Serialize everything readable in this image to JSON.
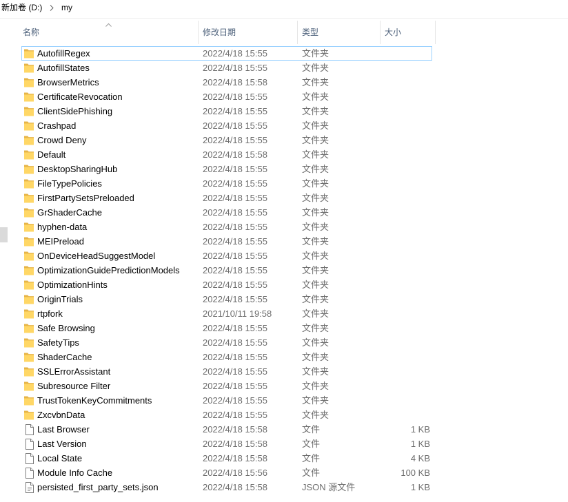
{
  "breadcrumb": {
    "items": [
      "新加卷 (D:)",
      "my"
    ],
    "separator_icon": "chevron-right-icon"
  },
  "header": {
    "name": "名称",
    "modified": "修改日期",
    "type": "类型",
    "size": "大小",
    "sort_icon": "sort-ascending-icon"
  },
  "files": [
    {
      "name": "AutofillRegex",
      "modified": "2022/4/18 15:55",
      "type": "文件夹",
      "icon": "folder-icon",
      "focused": true
    },
    {
      "name": "AutofillStates",
      "modified": "2022/4/18 15:55",
      "type": "文件夹",
      "icon": "folder-icon"
    },
    {
      "name": "BrowserMetrics",
      "modified": "2022/4/18 15:58",
      "type": "文件夹",
      "icon": "folder-icon"
    },
    {
      "name": "CertificateRevocation",
      "modified": "2022/4/18 15:55",
      "type": "文件夹",
      "icon": "folder-icon"
    },
    {
      "name": "ClientSidePhishing",
      "modified": "2022/4/18 15:55",
      "type": "文件夹",
      "icon": "folder-icon"
    },
    {
      "name": "Crashpad",
      "modified": "2022/4/18 15:55",
      "type": "文件夹",
      "icon": "folder-icon"
    },
    {
      "name": "Crowd Deny",
      "modified": "2022/4/18 15:55",
      "type": "文件夹",
      "icon": "folder-icon"
    },
    {
      "name": "Default",
      "modified": "2022/4/18 15:58",
      "type": "文件夹",
      "icon": "folder-icon"
    },
    {
      "name": "DesktopSharingHub",
      "modified": "2022/4/18 15:55",
      "type": "文件夹",
      "icon": "folder-icon"
    },
    {
      "name": "FileTypePolicies",
      "modified": "2022/4/18 15:55",
      "type": "文件夹",
      "icon": "folder-icon"
    },
    {
      "name": "FirstPartySetsPreloaded",
      "modified": "2022/4/18 15:55",
      "type": "文件夹",
      "icon": "folder-icon"
    },
    {
      "name": "GrShaderCache",
      "modified": "2022/4/18 15:55",
      "type": "文件夹",
      "icon": "folder-icon"
    },
    {
      "name": "hyphen-data",
      "modified": "2022/4/18 15:55",
      "type": "文件夹",
      "icon": "folder-icon"
    },
    {
      "name": "MEIPreload",
      "modified": "2022/4/18 15:55",
      "type": "文件夹",
      "icon": "folder-icon"
    },
    {
      "name": "OnDeviceHeadSuggestModel",
      "modified": "2022/4/18 15:55",
      "type": "文件夹",
      "icon": "folder-icon"
    },
    {
      "name": "OptimizationGuidePredictionModels",
      "modified": "2022/4/18 15:55",
      "type": "文件夹",
      "icon": "folder-icon"
    },
    {
      "name": "OptimizationHints",
      "modified": "2022/4/18 15:55",
      "type": "文件夹",
      "icon": "folder-icon"
    },
    {
      "name": "OriginTrials",
      "modified": "2022/4/18 15:55",
      "type": "文件夹",
      "icon": "folder-icon"
    },
    {
      "name": "rtpfork",
      "modified": "2021/10/11 19:58",
      "type": "文件夹",
      "icon": "folder-icon"
    },
    {
      "name": "Safe Browsing",
      "modified": "2022/4/18 15:55",
      "type": "文件夹",
      "icon": "folder-icon"
    },
    {
      "name": "SafetyTips",
      "modified": "2022/4/18 15:55",
      "type": "文件夹",
      "icon": "folder-icon"
    },
    {
      "name": "ShaderCache",
      "modified": "2022/4/18 15:55",
      "type": "文件夹",
      "icon": "folder-icon"
    },
    {
      "name": "SSLErrorAssistant",
      "modified": "2022/4/18 15:55",
      "type": "文件夹",
      "icon": "folder-icon"
    },
    {
      "name": "Subresource Filter",
      "modified": "2022/4/18 15:55",
      "type": "文件夹",
      "icon": "folder-icon"
    },
    {
      "name": "TrustTokenKeyCommitments",
      "modified": "2022/4/18 15:55",
      "type": "文件夹",
      "icon": "folder-icon"
    },
    {
      "name": "ZxcvbnData",
      "modified": "2022/4/18 15:55",
      "type": "文件夹",
      "icon": "folder-icon"
    },
    {
      "name": "Last Browser",
      "modified": "2022/4/18 15:58",
      "type": "文件",
      "size": "1 KB",
      "icon": "file-icon"
    },
    {
      "name": "Last Version",
      "modified": "2022/4/18 15:58",
      "type": "文件",
      "size": "1 KB",
      "icon": "file-icon"
    },
    {
      "name": "Local State",
      "modified": "2022/4/18 15:58",
      "type": "文件",
      "size": "4 KB",
      "icon": "file-icon"
    },
    {
      "name": "Module Info Cache",
      "modified": "2022/4/18 15:56",
      "type": "文件",
      "size": "100 KB",
      "icon": "file-icon"
    },
    {
      "name": "persisted_first_party_sets.json",
      "modified": "2022/4/18 15:58",
      "type": "JSON 源文件",
      "size": "1 KB",
      "icon": "json-file-icon"
    }
  ],
  "colors": {
    "focus_border": "#99d1ff",
    "header_text": "#4c607a",
    "secondary_text": "#6d6d6d",
    "folder_yellow": "#ffd766",
    "folder_back": "#e6b448"
  }
}
